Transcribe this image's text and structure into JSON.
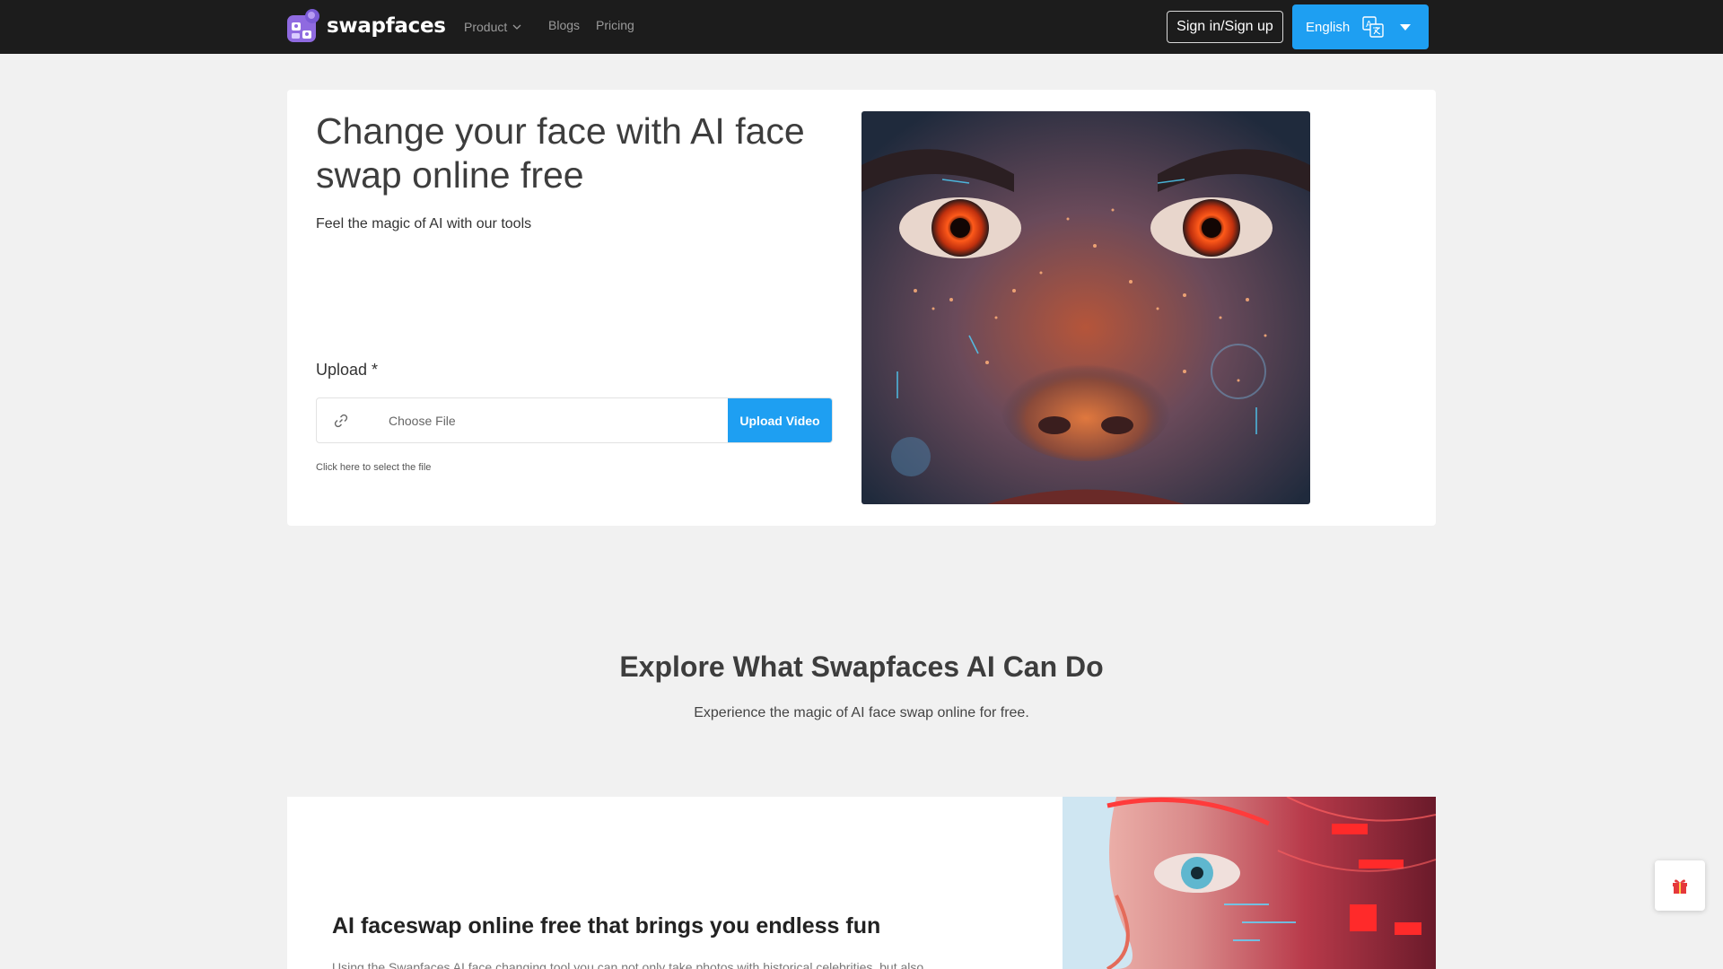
{
  "header": {
    "brand": "swapfaces",
    "nav": {
      "product": "Product",
      "blogs": "Blogs",
      "pricing": "Pricing"
    },
    "signin_label": "Sign in/Sign up",
    "language_label": "English"
  },
  "hero": {
    "title": "Change your face with AI face swap online free",
    "subtitle": "Feel the magic of AI with our tools",
    "upload_label": "Upload *",
    "choose_file": "Choose File",
    "upload_button": "Upload Video",
    "hint": "Click here to select the file"
  },
  "explore": {
    "title": "Explore What Swapfaces AI Can Do",
    "subtitle": "Experience the magic of AI face swap online for free."
  },
  "feature": {
    "title": "AI faceswap online free that brings you endless fun",
    "text": "Using the Swapfaces AI face changing tool you can not only take photos with historical celebrities, but also"
  },
  "colors": {
    "accent": "#1e9ff2",
    "header_bg": "#1c1c1c",
    "page_bg": "#f1f1f1"
  },
  "icons": [
    "swapfaces-logo-icon",
    "chevron-down-icon",
    "translate-icon",
    "caret-down-icon",
    "link-icon",
    "gift-icon"
  ]
}
